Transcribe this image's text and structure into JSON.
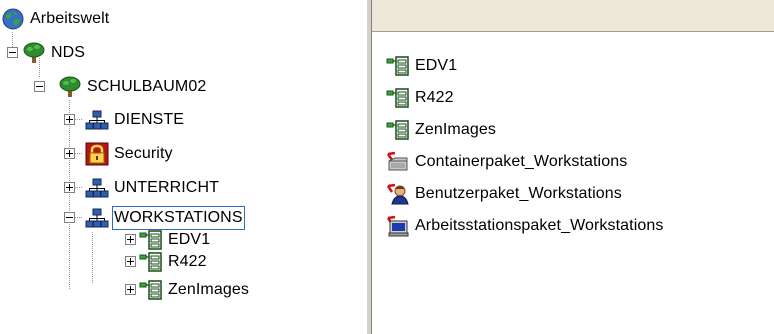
{
  "tree": {
    "root": {
      "label": "Arbeitswelt",
      "icon": "network-globe-icon"
    },
    "nds": {
      "label": "NDS",
      "icon": "tree-icon"
    },
    "schulbaum": {
      "label": "SCHULBAUM02",
      "icon": "tree-icon"
    },
    "dienste": {
      "label": "DIENSTE",
      "icon": "organizational-unit-icon"
    },
    "security": {
      "label": "Security",
      "icon": "security-lock-icon"
    },
    "unterricht": {
      "label": "UNTERRICHT",
      "icon": "organizational-unit-icon"
    },
    "workstations": {
      "label": "WORKSTATIONS",
      "icon": "organizational-unit-icon",
      "selected": true
    },
    "edv1": {
      "label": "EDV1",
      "icon": "workstation-group-icon"
    },
    "r422": {
      "label": "R422",
      "icon": "workstation-group-icon"
    },
    "zenimages": {
      "label": "ZenImages",
      "icon": "workstation-group-icon"
    }
  },
  "list": {
    "items": [
      {
        "label": "EDV1",
        "icon": "workstation-group-icon"
      },
      {
        "label": "R422",
        "icon": "workstation-group-icon"
      },
      {
        "label": "ZenImages",
        "icon": "workstation-group-icon"
      },
      {
        "label": "Containerpaket_Workstations",
        "icon": "container-package-icon"
      },
      {
        "label": "Benutzerpaket_Workstations",
        "icon": "user-package-icon"
      },
      {
        "label": "Arbeitsstationspaket_Workstations",
        "icon": "workstation-package-icon"
      }
    ]
  },
  "colors": {
    "selection_border": "#316ac5",
    "pane_header": "#ece9d8",
    "tree_foliage": "#2e8b2e",
    "ou_blue": "#2f5fa8",
    "lock_red": "#b01818",
    "policy_red": "#d01010"
  }
}
